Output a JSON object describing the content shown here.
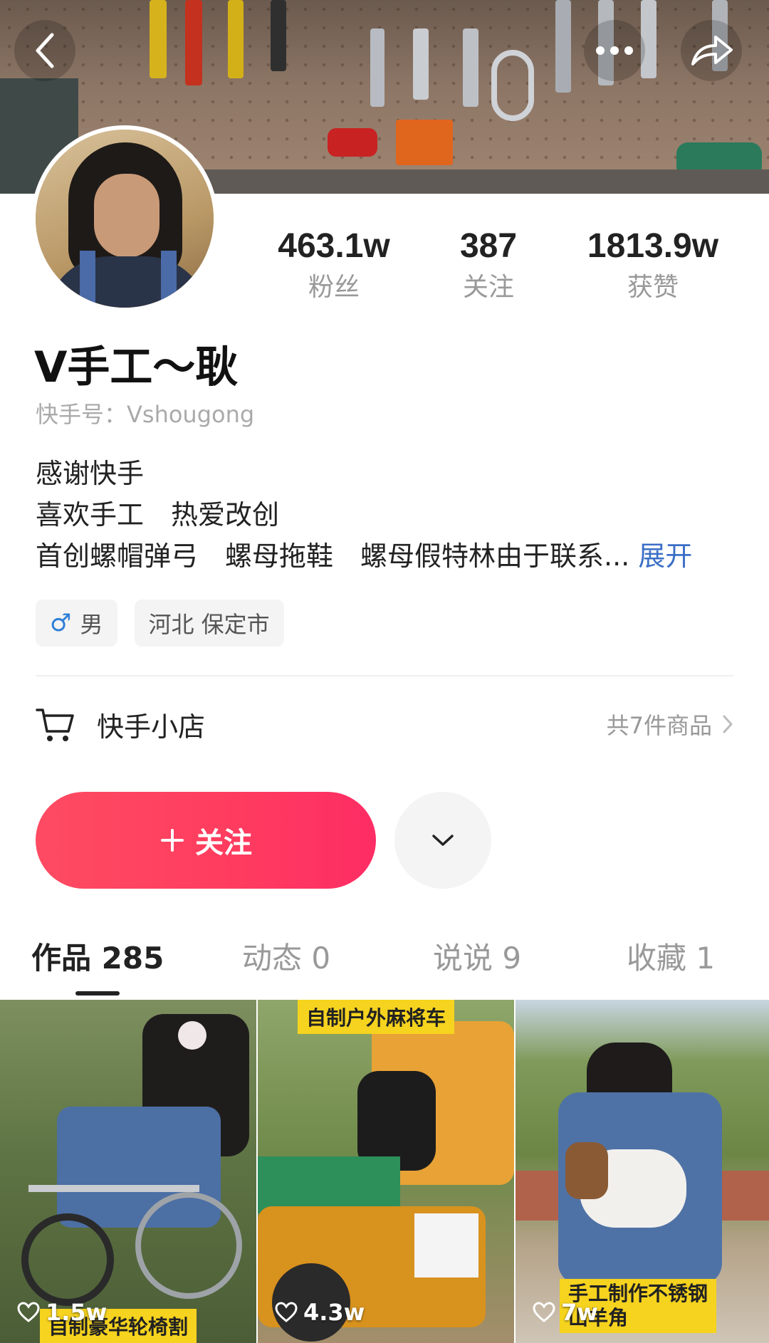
{
  "profile": {
    "stats": [
      {
        "value": "463.1w",
        "label": "粉丝"
      },
      {
        "value": "387",
        "label": "关注"
      },
      {
        "value": "1813.9w",
        "label": "获赞"
      }
    ],
    "name": "V手工～耿",
    "user_id": "快手号：Vshougong",
    "bio_lines": [
      "感谢快手",
      "喜欢手工　热爱改创",
      "首创螺帽弹弓　螺母拖鞋　螺母假特林由于联系..."
    ],
    "bio_expand": "展开",
    "gender_tag": "男",
    "gender_icon": "♂",
    "location_tag": "河北 保定市"
  },
  "shop": {
    "title": "快手小店",
    "count": "共7件商品"
  },
  "actions": {
    "follow_label": "关注"
  },
  "tabs": [
    {
      "label": "作品 285",
      "active": true
    },
    {
      "label": "动态 0",
      "active": false
    },
    {
      "label": "说说 9",
      "active": false
    },
    {
      "label": "收藏 1",
      "active": false
    }
  ],
  "videos": [
    {
      "likes": "1.5w",
      "caption": "自制豪华轮椅割"
    },
    {
      "likes": "4.3w",
      "caption": "自制户外麻将车"
    },
    {
      "likes": "7w",
      "caption_lines": [
        "手工制作不锈钢",
        "山羊角"
      ]
    }
  ],
  "colors": {
    "accent": "#fe3a62",
    "link": "#3b6fc6",
    "muted": "#999999"
  }
}
